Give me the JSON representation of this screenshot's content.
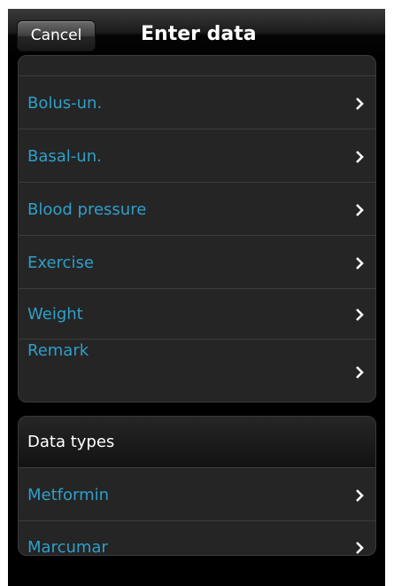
{
  "header": {
    "cancel_label": "Cancel",
    "title": "Enter data"
  },
  "group1": {
    "items": [
      {
        "label": "Bolus-un."
      },
      {
        "label": "Basal-un."
      },
      {
        "label": "Blood pressure"
      },
      {
        "label": "Exercise"
      },
      {
        "label": "Weight"
      },
      {
        "label": "Remark"
      }
    ]
  },
  "group2": {
    "title": "Data types",
    "items": [
      {
        "label": "Metformin"
      },
      {
        "label": "Marcumar"
      }
    ]
  },
  "colors": {
    "link_text": "#2f9fc9",
    "background": "#000000",
    "group_background": "#252525"
  },
  "icons": {
    "row_disclosure": "chevron-right-icon"
  }
}
